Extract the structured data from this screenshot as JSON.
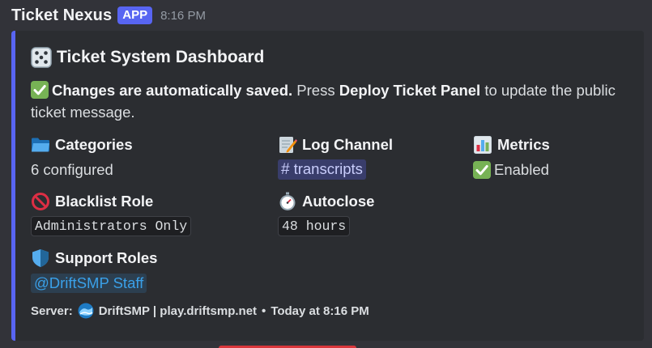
{
  "message": {
    "bot_name": "Ticket Nexus",
    "app_tag": "APP",
    "time": "8:16 PM"
  },
  "embed": {
    "accent_color": "#5865f2",
    "title": "Ticket System Dashboard",
    "description_bold": "Changes are automatically saved.",
    "description_mid": " Press ",
    "description_bold2": "Deploy Ticket Panel",
    "description_end": " to update the public ticket message.",
    "fields": {
      "categories": {
        "name": "Categories",
        "value": "6 configured",
        "icon": "folder-icon"
      },
      "log_channel": {
        "name": "Log Channel",
        "value": "transcripts",
        "prefix": "#",
        "icon": "memo-icon"
      },
      "metrics": {
        "name": "Metrics",
        "value": "Enabled",
        "icon": "bar-chart-icon"
      },
      "blacklist": {
        "name": "Blacklist Role",
        "value": "Administrators Only",
        "icon": "no-entry-icon"
      },
      "autoclose": {
        "name": "Autoclose",
        "value": "48 hours",
        "icon": "stopwatch-icon"
      },
      "support_roles": {
        "name": "Support Roles",
        "value": "@DriftSMP Staff",
        "icon": "shield-icon"
      }
    },
    "footer": {
      "prefix": "Server:",
      "server": "DriftSMP | play.driftsmp.net",
      "separator": "•",
      "time": "Today at 8:16 PM"
    }
  }
}
